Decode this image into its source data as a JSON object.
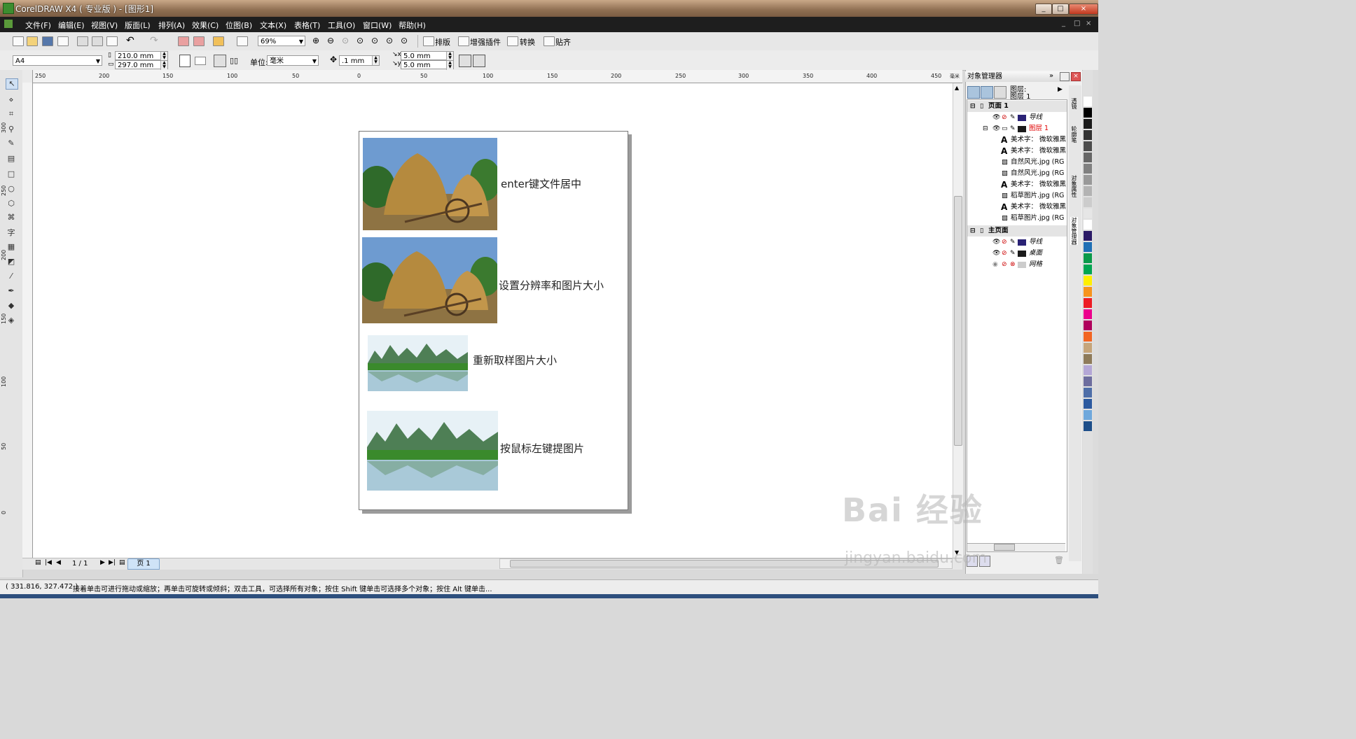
{
  "window": {
    "title": "CorelDRAW X4 ( 专业版 ) - [图形1]",
    "controls": [
      "_",
      "□",
      "×"
    ]
  },
  "menu": [
    "文件(F)",
    "编辑(E)",
    "视图(V)",
    "版面(L)",
    "排列(A)",
    "效果(C)",
    "位图(B)",
    "文本(X)",
    "表格(T)",
    "工具(O)",
    "窗口(W)",
    "帮助(H)"
  ],
  "mdi_controls": [
    "_",
    "□",
    "×"
  ],
  "toolbar1": {
    "zoom": "69%",
    "buttons": [
      "排版",
      "增强插件",
      "转换",
      "贴齐"
    ]
  },
  "toolbar2": {
    "page_size": "A4",
    "width": "210.0 mm",
    "height": "297.0 mm",
    "unit_label": "单位:",
    "unit": "毫米",
    "nudge": ".1 mm",
    "dup_x": "5.0 mm",
    "dup_y": "5.0 mm"
  },
  "ruler": {
    "h_ticks": [
      "250",
      "200",
      "150",
      "100",
      "50",
      "0",
      "50",
      "100",
      "150",
      "200",
      "250",
      "300",
      "350",
      "400",
      "450"
    ],
    "h_unit": "毫米",
    "v_ticks": [
      "300",
      "250",
      "200",
      "150",
      "100",
      "50",
      "0"
    ]
  },
  "document": {
    "items": [
      {
        "caption": "enter键文件居中",
        "image": "稻草图片"
      },
      {
        "caption": "设置分辨率和图片大小",
        "image": "稻草图片"
      },
      {
        "caption": "重新取样图片大小",
        "image": "自然风光"
      },
      {
        "caption": "按鼠标左键提图片",
        "image": "自然风光"
      }
    ]
  },
  "pagebar": {
    "counter": "1 / 1",
    "tab": "页 1"
  },
  "docker": {
    "title": "对象管理器",
    "layer_label_1": "图层:",
    "layer_label_2": "图层 1",
    "tree": [
      {
        "label": "页面 1",
        "type": "header"
      },
      {
        "label": "导线",
        "type": "layer",
        "color": "#2a2275"
      },
      {
        "label": "图层 1",
        "type": "layer-active",
        "color": "#1a1a1a"
      },
      {
        "label": "美术字： 微软雅黑",
        "type": "obj",
        "icon": "A"
      },
      {
        "label": "美术字： 微软雅黑",
        "type": "obj",
        "icon": "A"
      },
      {
        "label": "自然风光.jpg (RG",
        "type": "obj",
        "icon": "img"
      },
      {
        "label": "自然风光.jpg (RG",
        "type": "obj",
        "icon": "img"
      },
      {
        "label": "美术字： 微软雅黑",
        "type": "obj",
        "icon": "A"
      },
      {
        "label": "稻草图片.jpg (RG",
        "type": "obj",
        "icon": "img"
      },
      {
        "label": "美术字： 微软雅黑",
        "type": "obj",
        "icon": "A"
      },
      {
        "label": "稻草图片.jpg (RG",
        "type": "obj",
        "icon": "img"
      },
      {
        "label": "主页面",
        "type": "header"
      },
      {
        "label": "导线",
        "type": "layer",
        "color": "#2a2275"
      },
      {
        "label": "桌面",
        "type": "layer",
        "color": "#1a1a1a"
      },
      {
        "label": "网格",
        "type": "layer",
        "color": "#cccccc"
      }
    ],
    "side_tabs": [
      "透镜",
      "轮廓笔",
      "对象属性",
      "对象管理器"
    ]
  },
  "palette": [
    "#ffffff",
    "#000000",
    "#1a1a1a",
    "#333333",
    "#4d4d4d",
    "#666666",
    "#808080",
    "#999999",
    "#b3b3b3",
    "#cccccc",
    "#e6e6e6",
    "#ffffff",
    "#2b1a66",
    "#1f6fb5",
    "#0a9a4a",
    "#00a651",
    "#ffef00",
    "#f7941d",
    "#ed1c24",
    "#ec008c",
    "#b0005d",
    "#f26522",
    "#c6a57a",
    "#8e7b5a",
    "#b4a7d6",
    "#6d6d9e",
    "#4e6ea8",
    "#2c5aa0",
    "#6fa8dc",
    "#1d4e89"
  ],
  "status": {
    "coords": "( 331.816, 327.472 )",
    "hint": "接着单击可进行拖动或缩放；再单击可旋转或倾斜；双击工具，可选择所有对象；按住 Shift 键单击可选择多个对象；按住 Alt 键单击..."
  },
  "watermark": {
    "logo": "Bai 经验",
    "url": "jingyan.baidu.com"
  }
}
